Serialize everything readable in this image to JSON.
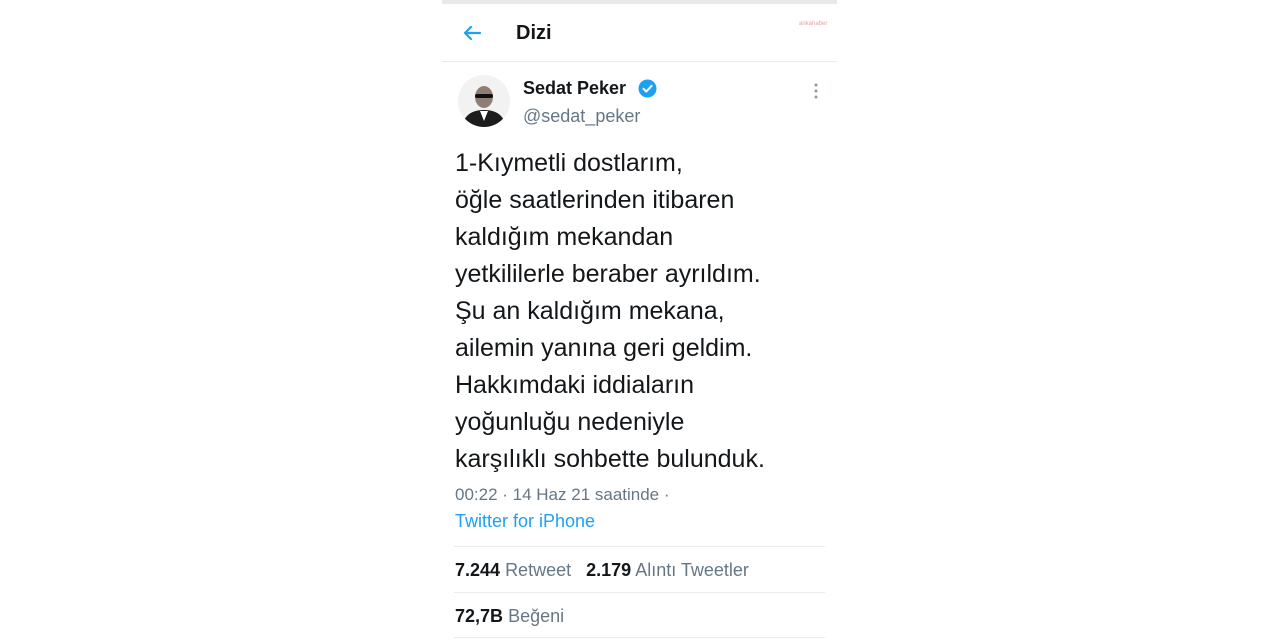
{
  "header": {
    "title": "Dizi",
    "back_icon": "arrow-left-icon",
    "watermark": "ankahaber"
  },
  "tweet": {
    "display_name": "Sedat Peker",
    "verified_icon": "verified-badge-icon",
    "handle": "@sedat_peker",
    "more_icon": "more-vertical-icon",
    "lines": [
      "1-Kıymetli dostlarım,",
      "öğle saatlerinden itibaren",
      "kaldığım mekandan",
      "yetkililerle beraber ayrıldım.",
      "Şu an kaldığım mekana,",
      "ailemin yanına geri geldim.",
      "Hakkımdaki iddiaların",
      "yoğunluğu nedeniyle",
      "karşılıklı sohbette bulunduk."
    ],
    "meta": "00:22 · 14 Haz 21 saatinde ·",
    "source": "Twitter for iPhone"
  },
  "stats": {
    "retweets_count": "7.244",
    "retweets_label": "Retweet",
    "quotes_count": "2.179",
    "quotes_label": "Alıntı Tweetler",
    "likes_count": "72,7B",
    "likes_label": "Beğeni"
  },
  "colors": {
    "accent": "#1da1f2",
    "text": "#14171a",
    "secondary": "#657786",
    "divider": "#e6ecf0"
  }
}
